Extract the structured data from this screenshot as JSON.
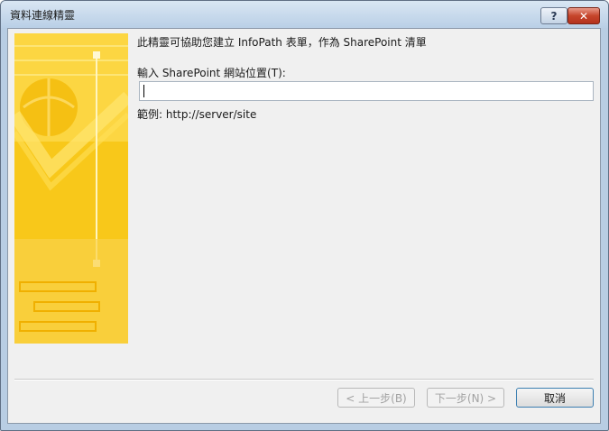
{
  "window": {
    "title": "資料連線精靈",
    "help_label": "?",
    "close_label": "✕"
  },
  "main": {
    "heading": "此精靈可協助您建立 InfoPath 表單，作為 SharePoint 清單",
    "field_label": "輸入 SharePoint 網站位置(T):",
    "url_value": "",
    "example": "範例: http://server/site"
  },
  "buttons": {
    "back": "< 上一步(B)",
    "next": "下一步(N) >",
    "cancel": "取消"
  }
}
